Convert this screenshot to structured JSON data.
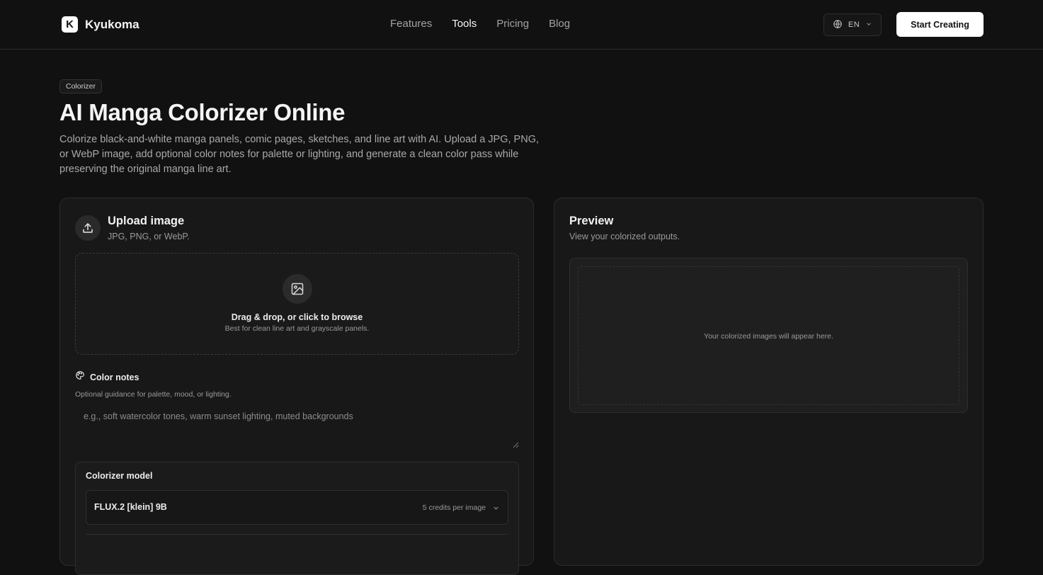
{
  "header": {
    "brand_initial": "K",
    "brand_name": "Kyukoma",
    "nav": [
      {
        "label": "Features"
      },
      {
        "label": "Tools"
      },
      {
        "label": "Pricing"
      },
      {
        "label": "Blog"
      }
    ],
    "active_nav": "Tools",
    "language": "EN",
    "cta_label": "Start Creating"
  },
  "hero": {
    "badge": "Colorizer",
    "title": "AI Manga Colorizer Online",
    "subtitle": "Colorize black-and-white manga panels, comic pages, sketches, and line art with AI. Upload a JPG, PNG, or WebP image, add optional color notes for palette or lighting, and generate a clean color pass while preserving the original manga line art."
  },
  "upload": {
    "title": "Upload image",
    "subtitle": "JPG, PNG, or WebP.",
    "drop_title": "Drag & drop, or click to browse",
    "drop_sub": "Best for clean line art and grayscale panels."
  },
  "notes": {
    "label": "Color notes",
    "help": "Optional guidance for palette, mood, or lighting.",
    "placeholder": "e.g., soft watercolor tones, warm sunset lighting, muted backgrounds",
    "value": ""
  },
  "model": {
    "label": "Colorizer model",
    "selected": "FLUX.2 [klein] 9B",
    "credits": "5 credits per image"
  },
  "preview": {
    "title": "Preview",
    "subtitle": "View your colorized outputs.",
    "empty_text": "Your colorized images will appear here."
  },
  "icons": {
    "upload": "upload-icon",
    "image": "image-icon",
    "palette": "palette-icon",
    "globe": "globe-icon",
    "chevron": "chevron-down-icon"
  },
  "colors": {
    "background": "#111111",
    "panel": "#181818",
    "cta_bg": "#ffffff"
  }
}
